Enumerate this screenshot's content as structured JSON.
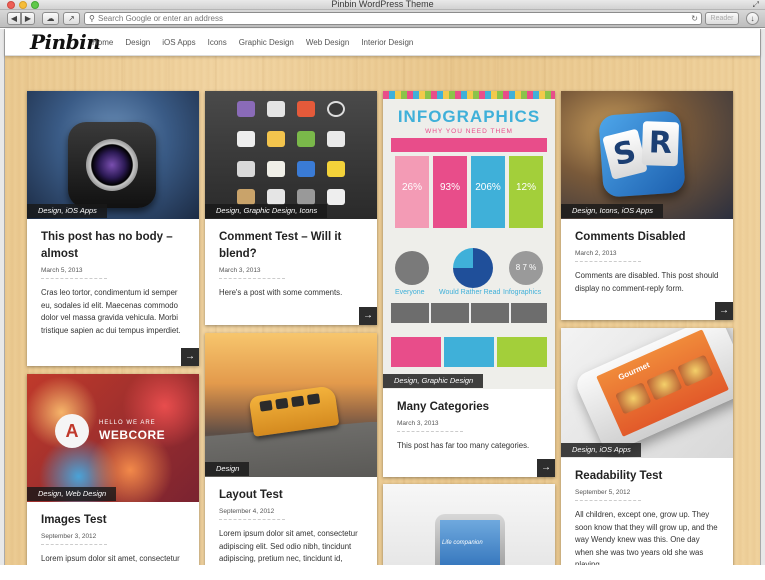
{
  "window": {
    "title": "Pinbin WordPress Theme",
    "address_placeholder": "Search Google or enter an address",
    "reader_label": "Reader"
  },
  "site": {
    "logo": "Pinbin",
    "nav": [
      "Home",
      "Design",
      "iOS Apps",
      "Icons",
      "Graphic Design",
      "Web Design",
      "Interior Design"
    ]
  },
  "cards": [
    {
      "category": "Design, iOS Apps",
      "title": "This post has no body – almost",
      "date": "March 5, 2013",
      "excerpt": "Cras leo tortor, condimentum id semper eu, sodales id elit. Maecenas commodo dolor vel massa gravida vehicula. Morbi tristique sapien ac dui tempus imperdiet.",
      "more": "→"
    },
    {
      "category": "Design, Graphic Design, Icons",
      "title": "Comment Test – Will it blend?",
      "date": "March 3, 2013",
      "excerpt": "Here's a post with some comments.",
      "more": "→"
    },
    {
      "category": "Design, Graphic Design",
      "title": "Many Categories",
      "date": "March 3, 2013",
      "excerpt": "This post has far too many categories.",
      "more": "→"
    },
    {
      "category": "Design, Icons, iOS Apps",
      "title": "Comments Disabled",
      "date": "March 2, 2013",
      "excerpt": "Comments are disabled. This post should display no comment-reply form.",
      "more": "→"
    },
    {
      "category": "Design, Web Design",
      "title": "Images Test",
      "date": "September 3, 2012",
      "excerpt": "Lorem ipsum dolor sit amet, consectetur"
    },
    {
      "category": "Design",
      "title": "Layout Test",
      "date": "September 4, 2012",
      "excerpt": "Lorem ipsum dolor sit amet, consectetur adipiscing elit. Sed odio nibh, tincidunt adipiscing, pretium nec, tincidunt id, enim."
    },
    {
      "category": "Design, iOS Apps",
      "title": "Readability Test",
      "date": "September 5, 2012",
      "excerpt": "All children, except one, grow up. They soon know that they will grow up, and the way Wendy knew was this. One day when she was two years old she was playing"
    }
  ],
  "images": {
    "webcore_small": "HELLO WE ARE",
    "webcore_big": "WEBCORE",
    "infographic_title": "INFOGRAPHICS",
    "infographic_subtitle": "WHY YOU NEED THEM",
    "infographic_percents": [
      "26%",
      "93%",
      "206%",
      "12%"
    ],
    "infographic_words": [
      "Everyone",
      "Would Rather Read",
      "Infographics"
    ],
    "infographic_stat": "8 7 %",
    "phone_app": "Gourmet",
    "samsung_text": "Life companion",
    "tile_letters": [
      "S",
      "R"
    ],
    "webcore_logo_letter": "A"
  }
}
